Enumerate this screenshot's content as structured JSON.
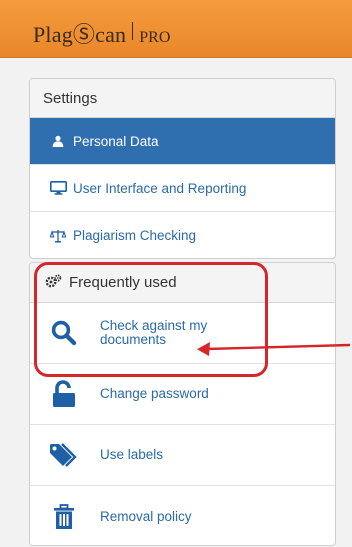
{
  "brand": {
    "name": "PlagⓈcan",
    "edition": "PRO"
  },
  "settings": {
    "title": "Settings",
    "items": [
      {
        "label": "Personal Data",
        "icon": "user-icon",
        "active": true
      },
      {
        "label": "User Interface and Reporting",
        "icon": "monitor-icon",
        "active": false
      },
      {
        "label": "Plagiarism Checking",
        "icon": "scale-icon",
        "active": false
      }
    ]
  },
  "frequent": {
    "title": "Frequently used",
    "icon": "gears-icon",
    "items": [
      {
        "label": "Check against my documents",
        "icon": "search-icon"
      },
      {
        "label": "Change password",
        "icon": "unlock-icon"
      },
      {
        "label": "Use labels",
        "icon": "tags-icon"
      },
      {
        "label": "Removal policy",
        "icon": "trash-icon"
      }
    ]
  },
  "colors": {
    "topbar": "#f0912f",
    "active_row": "#2f6fb0",
    "link": "#2a6aa8",
    "icon_blue": "#1f5fa6",
    "annotation_red": "#d5262a"
  }
}
